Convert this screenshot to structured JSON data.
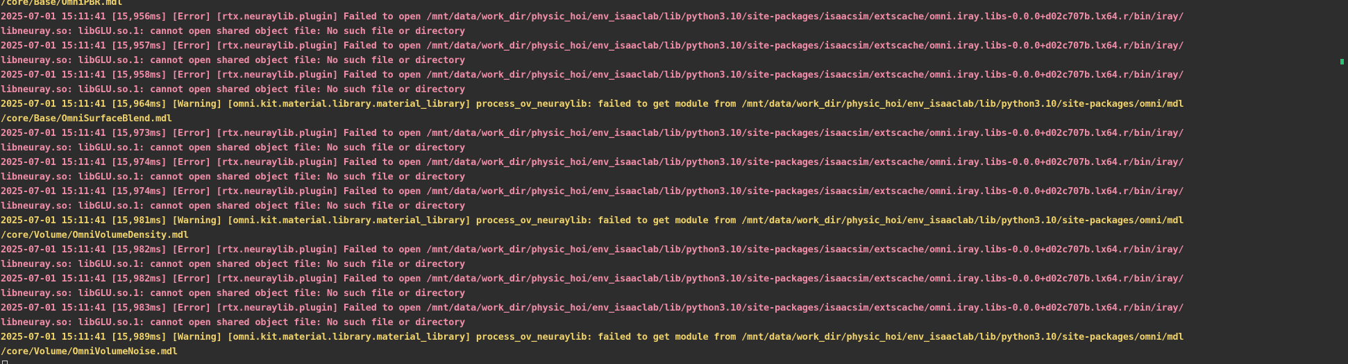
{
  "colors": {
    "background": "#2d2d2d",
    "error": "#f28da9",
    "warning": "#f0d36a",
    "prompt": "#d8d8d8",
    "scroll_marker": "#27c26d"
  },
  "lines": [
    {
      "level": "warn",
      "text": "/core/Base/OmniPBR.mdl"
    },
    {
      "level": "err",
      "text": "2025-07-01 15:11:41 [15,956ms] [Error] [rtx.neuraylib.plugin] Failed to open /mnt/data/work_dir/physic_hoi/env_isaaclab/lib/python3.10/site-packages/isaacsim/extscache/omni.iray.libs-0.0.0+d02c707b.lx64.r/bin/iray/"
    },
    {
      "level": "err",
      "text": "libneuray.so: libGLU.so.1: cannot open shared object file: No such file or directory"
    },
    {
      "level": "err",
      "text": "2025-07-01 15:11:41 [15,957ms] [Error] [rtx.neuraylib.plugin] Failed to open /mnt/data/work_dir/physic_hoi/env_isaaclab/lib/python3.10/site-packages/isaacsim/extscache/omni.iray.libs-0.0.0+d02c707b.lx64.r/bin/iray/"
    },
    {
      "level": "err",
      "text": "libneuray.so: libGLU.so.1: cannot open shared object file: No such file or directory"
    },
    {
      "level": "err",
      "text": "2025-07-01 15:11:41 [15,958ms] [Error] [rtx.neuraylib.plugin] Failed to open /mnt/data/work_dir/physic_hoi/env_isaaclab/lib/python3.10/site-packages/isaacsim/extscache/omni.iray.libs-0.0.0+d02c707b.lx64.r/bin/iray/"
    },
    {
      "level": "err",
      "text": "libneuray.so: libGLU.so.1: cannot open shared object file: No such file or directory"
    },
    {
      "level": "warn",
      "text": "2025-07-01 15:11:41 [15,964ms] [Warning] [omni.kit.material.library.material_library] process_ov_neuraylib: failed to get module from /mnt/data/work_dir/physic_hoi/env_isaaclab/lib/python3.10/site-packages/omni/mdl"
    },
    {
      "level": "warn",
      "text": "/core/Base/OmniSurfaceBlend.mdl"
    },
    {
      "level": "err",
      "text": "2025-07-01 15:11:41 [15,973ms] [Error] [rtx.neuraylib.plugin] Failed to open /mnt/data/work_dir/physic_hoi/env_isaaclab/lib/python3.10/site-packages/isaacsim/extscache/omni.iray.libs-0.0.0+d02c707b.lx64.r/bin/iray/"
    },
    {
      "level": "err",
      "text": "libneuray.so: libGLU.so.1: cannot open shared object file: No such file or directory"
    },
    {
      "level": "err",
      "text": "2025-07-01 15:11:41 [15,974ms] [Error] [rtx.neuraylib.plugin] Failed to open /mnt/data/work_dir/physic_hoi/env_isaaclab/lib/python3.10/site-packages/isaacsim/extscache/omni.iray.libs-0.0.0+d02c707b.lx64.r/bin/iray/"
    },
    {
      "level": "err",
      "text": "libneuray.so: libGLU.so.1: cannot open shared object file: No such file or directory"
    },
    {
      "level": "err",
      "text": "2025-07-01 15:11:41 [15,974ms] [Error] [rtx.neuraylib.plugin] Failed to open /mnt/data/work_dir/physic_hoi/env_isaaclab/lib/python3.10/site-packages/isaacsim/extscache/omni.iray.libs-0.0.0+d02c707b.lx64.r/bin/iray/"
    },
    {
      "level": "err",
      "text": "libneuray.so: libGLU.so.1: cannot open shared object file: No such file or directory"
    },
    {
      "level": "warn",
      "text": "2025-07-01 15:11:41 [15,981ms] [Warning] [omni.kit.material.library.material_library] process_ov_neuraylib: failed to get module from /mnt/data/work_dir/physic_hoi/env_isaaclab/lib/python3.10/site-packages/omni/mdl"
    },
    {
      "level": "warn",
      "text": "/core/Volume/OmniVolumeDensity.mdl"
    },
    {
      "level": "err",
      "text": "2025-07-01 15:11:41 [15,982ms] [Error] [rtx.neuraylib.plugin] Failed to open /mnt/data/work_dir/physic_hoi/env_isaaclab/lib/python3.10/site-packages/isaacsim/extscache/omni.iray.libs-0.0.0+d02c707b.lx64.r/bin/iray/"
    },
    {
      "level": "err",
      "text": "libneuray.so: libGLU.so.1: cannot open shared object file: No such file or directory"
    },
    {
      "level": "err",
      "text": "2025-07-01 15:11:41 [15,982ms] [Error] [rtx.neuraylib.plugin] Failed to open /mnt/data/work_dir/physic_hoi/env_isaaclab/lib/python3.10/site-packages/isaacsim/extscache/omni.iray.libs-0.0.0+d02c707b.lx64.r/bin/iray/"
    },
    {
      "level": "err",
      "text": "libneuray.so: libGLU.so.1: cannot open shared object file: No such file or directory"
    },
    {
      "level": "err",
      "text": "2025-07-01 15:11:41 [15,983ms] [Error] [rtx.neuraylib.plugin] Failed to open /mnt/data/work_dir/physic_hoi/env_isaaclab/lib/python3.10/site-packages/isaacsim/extscache/omni.iray.libs-0.0.0+d02c707b.lx64.r/bin/iray/"
    },
    {
      "level": "err",
      "text": "libneuray.so: libGLU.so.1: cannot open shared object file: No such file or directory"
    },
    {
      "level": "warn",
      "text": "2025-07-01 15:11:41 [15,989ms] [Warning] [omni.kit.material.library.material_library] process_ov_neuraylib: failed to get module from /mnt/data/work_dir/physic_hoi/env_isaaclab/lib/python3.10/site-packages/omni/mdl"
    },
    {
      "level": "warn",
      "text": "/core/Volume/OmniVolumeNoise.mdl"
    }
  ],
  "prompt": {
    "text": ""
  }
}
